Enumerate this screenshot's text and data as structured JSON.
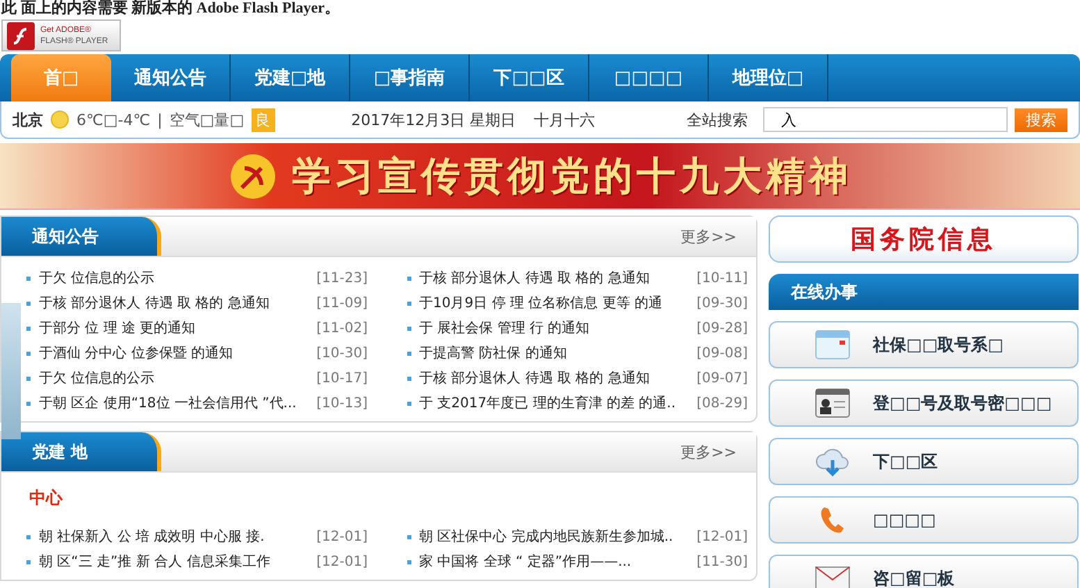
{
  "flash_notice": {
    "message": "此 面上的内容需要 新版本的 Adobe Flash Player。",
    "badge_line1": "Get ADOBE®",
    "badge_line2": "FLASH® PLAYER"
  },
  "nav": [
    {
      "label": "首□",
      "selected": true
    },
    {
      "label": "通知公告",
      "selected": false
    },
    {
      "label": "党建□地",
      "selected": false
    },
    {
      "label": "□事指南",
      "selected": false
    },
    {
      "label": "下□□区",
      "selected": false
    },
    {
      "label": "□□□□",
      "selected": false
    },
    {
      "label": "地理位□",
      "selected": false
    }
  ],
  "info_bar": {
    "city": "北京",
    "temperature": "6℃□-4℃",
    "separator": "|",
    "air_label": "空气□量□",
    "air_quality": "良",
    "date": "2017年12月3日 星期日",
    "lunar_date": "十月十六",
    "search_label": "全站搜索",
    "search_value": "入",
    "search_button": "搜索"
  },
  "banner": {
    "title": "学习宣传贯彻党的十九大精神"
  },
  "notices": {
    "title": "通知公告",
    "more": "更多>>",
    "items": [
      {
        "title": "于欠  位信息的公示",
        "date": "[11-23]"
      },
      {
        "title": "于核 部分退休人 待遇 取 格的 急通知",
        "date": "[11-09]"
      },
      {
        "title": "于部分 位 理  途  更的通知",
        "date": "[11-02]"
      },
      {
        "title": "于酒仙 分中心   位参保暨   的通知",
        "date": "[10-30]"
      },
      {
        "title": "于欠  位信息的公示",
        "date": "[10-17]"
      },
      {
        "title": "于朝 区企 使用“18位 一社会信用代 ”代...",
        "date": "[10-13]"
      },
      {
        "title": "于核 部分退休人 待遇 取 格的 急通知",
        "date": "[10-11]"
      },
      {
        "title": "于10月9日 停 理 位名称信息 更等  的通",
        "date": "[09-30]"
      },
      {
        "title": "于 展社会保    管理  行  的通知",
        "date": "[09-28]"
      },
      {
        "title": "于提高警  防社保      的通知",
        "date": "[09-08]"
      },
      {
        "title": "于核 部分退休人 待遇 取 格的 急通知",
        "date": "[09-07]"
      },
      {
        "title": "于 支2017年度已 理的生育津 的差 的通..",
        "date": "[08-29]"
      }
    ]
  },
  "party": {
    "title": "党建 地",
    "more": "更多>>",
    "subheading": "中心",
    "items": [
      {
        "title": "朝 社保新入 公  培 成效明    中心服 接.",
        "date": "[12-01]"
      },
      {
        "title": "朝 区社保中心  完成内地民族新生参加城..",
        "date": "[12-01]"
      },
      {
        "title": "朝 区“三 走”推 新 合人 信息采集工作",
        "date": "[12-01]"
      },
      {
        "title": "   家 中国将    全球 “ 定器”作用——...",
        "date": "[11-30]"
      }
    ]
  },
  "state_council": {
    "title": "国务院信息"
  },
  "online_services": {
    "title": "在线办事",
    "items": [
      {
        "kind": "window",
        "label": "社保□□取号系□"
      },
      {
        "kind": "card",
        "label": "登□□号及取号密□□□"
      },
      {
        "kind": "cloud",
        "label": "下□□区"
      },
      {
        "kind": "phone",
        "label": "□□□□"
      },
      {
        "kind": "mail",
        "label": "咨□留□板"
      }
    ]
  }
}
